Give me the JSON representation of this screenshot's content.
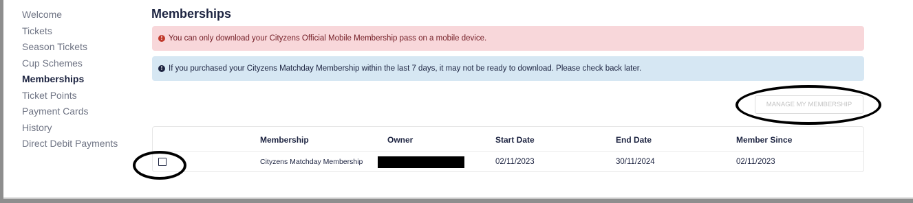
{
  "sidebar": {
    "items": [
      {
        "label": "Welcome"
      },
      {
        "label": "Tickets"
      },
      {
        "label": "Season Tickets"
      },
      {
        "label": "Cup Schemes"
      },
      {
        "label": "Memberships"
      },
      {
        "label": "Ticket Points"
      },
      {
        "label": "Payment Cards"
      },
      {
        "label": "History"
      },
      {
        "label": "Direct Debit Payments"
      }
    ],
    "active_item": "Memberships"
  },
  "page": {
    "title": "Memberships"
  },
  "alerts": {
    "danger": {
      "icon": "exclamation-circle-icon",
      "text": "You can only download your Cityzens Official Mobile Membership pass on a mobile device."
    },
    "info": {
      "icon": "info-circle-icon",
      "text": "If you purchased your Cityzens Matchday Membership within the last 7 days, it may not be ready to download. Please check back later."
    }
  },
  "manage_button": {
    "label": "MANAGE MY MEMBERSHIP",
    "disabled": true
  },
  "table": {
    "columns": [
      "Membership",
      "Owner",
      "Start Date",
      "End Date",
      "Member Since"
    ],
    "rows": [
      {
        "selected": false,
        "membership": "Cityzens Matchday Membership",
        "owner": "",
        "start_date": "02/11/2023",
        "end_date": "30/11/2024",
        "member_since": "02/11/2023"
      }
    ]
  },
  "colors": {
    "alert_danger_bg": "#f8d7da",
    "alert_info_bg": "#d6e7f3",
    "text_primary": "#1c2340",
    "text_muted": "#6f7484"
  }
}
